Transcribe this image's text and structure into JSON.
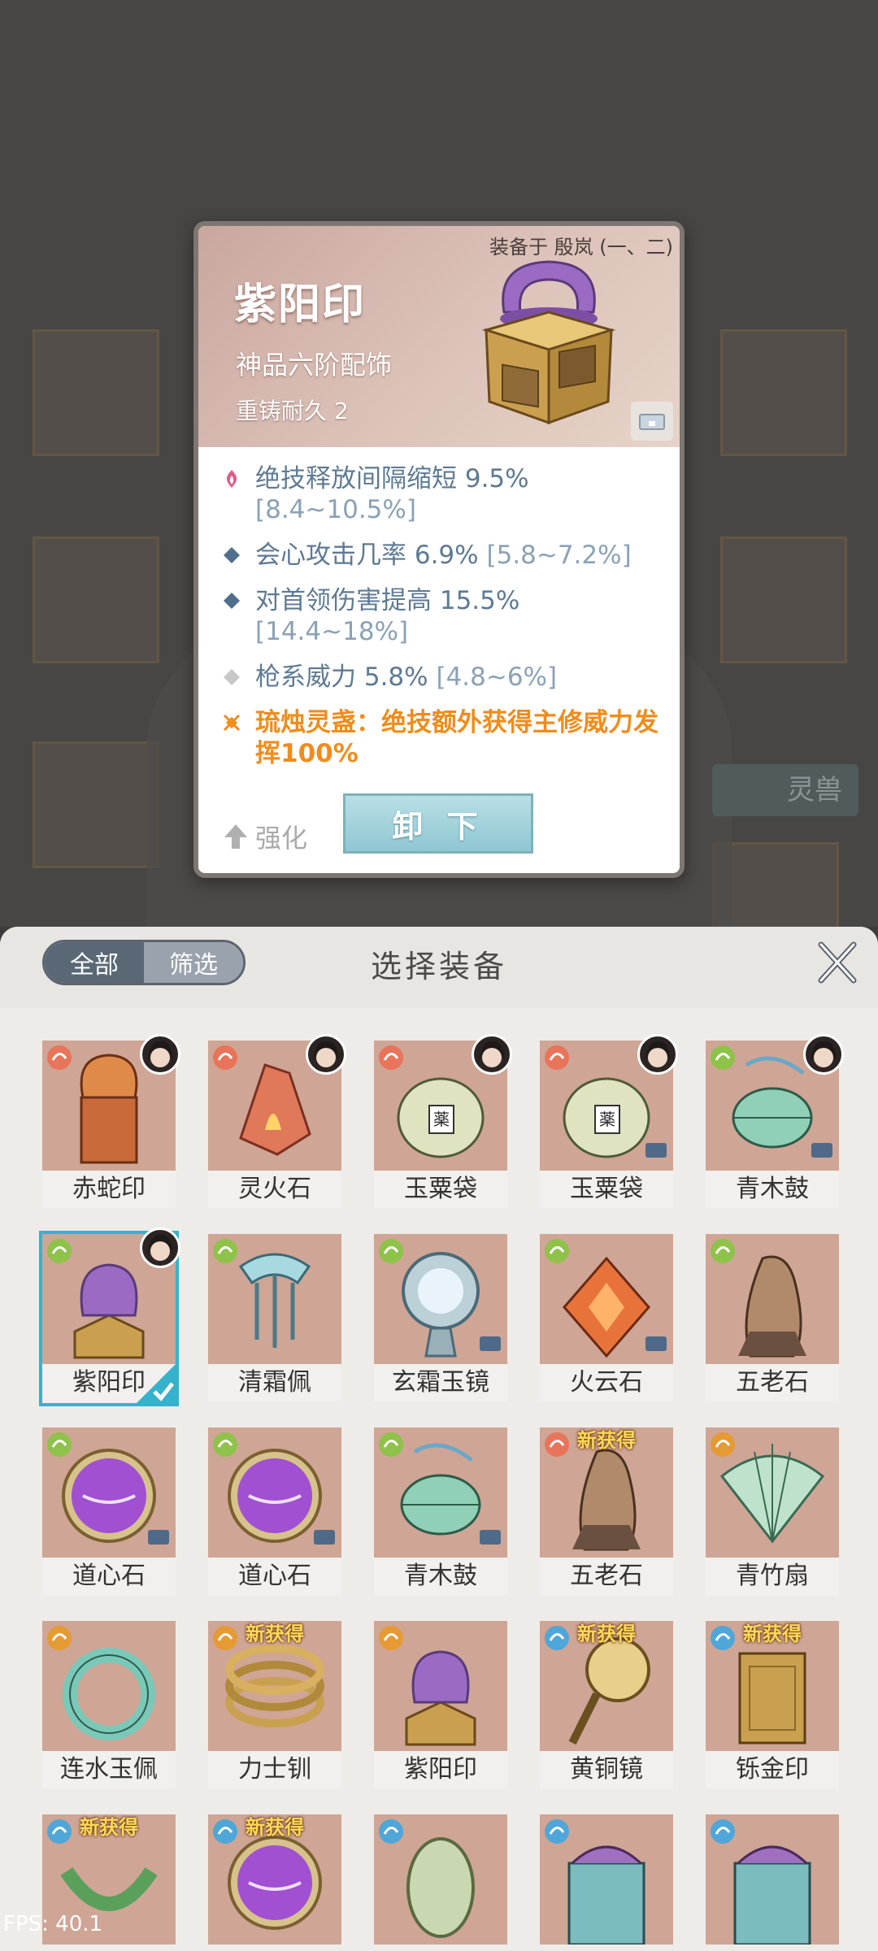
{
  "detail": {
    "equipped_note": "装备于 殷岚 (一、二)",
    "name": "紫阳印",
    "grade": "神品六阶配饰",
    "durability": "重铸耐久 2",
    "stats": [
      {
        "icon": "flame-icon",
        "text": "绝技释放间隔缩短 9.5% ",
        "range": "[8.4~10.5%]",
        "color": "#c55a7a"
      },
      {
        "icon": "diamond-icon",
        "text": "会心攻击几率 6.9% ",
        "range": "[5.8~7.2%]",
        "color": "#4f6f8c"
      },
      {
        "icon": "diamond-icon",
        "text": "对首领伤害提高 15.5% ",
        "range": "[14.4~18%]",
        "color": "#4f6f8c"
      },
      {
        "icon": "diamond-icon",
        "text": "枪系威力 5.8% ",
        "range": "[4.8~6%]",
        "color": "#bbbbbb"
      }
    ],
    "special": {
      "icon": "rune-icon",
      "text": "琉烛灵盏：绝技额外获得主修威力发挥100%"
    },
    "enhance_label": "强化",
    "unequip_label": "卸 下"
  },
  "panel": {
    "tabs": [
      {
        "label": "全部",
        "active": true
      },
      {
        "label": "筛选",
        "active": false
      }
    ],
    "title": "选择装备"
  },
  "items": [
    {
      "name": "赤蛇印",
      "rarity": "red",
      "owner": true,
      "art": "seal-orange"
    },
    {
      "name": "灵火石",
      "rarity": "red",
      "owner": true,
      "art": "fire-stone"
    },
    {
      "name": "玉粟袋",
      "rarity": "red",
      "owner": true,
      "art": "pouch"
    },
    {
      "name": "玉粟袋",
      "rarity": "red",
      "owner": true,
      "chest": true,
      "art": "pouch"
    },
    {
      "name": "青木鼓",
      "rarity": "green",
      "owner": true,
      "chest": true,
      "art": "drum"
    },
    {
      "name": "紫阳印",
      "rarity": "green",
      "owner": true,
      "selected": true,
      "art": "seal-purple"
    },
    {
      "name": "清霜佩",
      "rarity": "green",
      "art": "pendant"
    },
    {
      "name": "玄霜玉镜",
      "rarity": "green",
      "chest": true,
      "art": "mirror"
    },
    {
      "name": "火云石",
      "rarity": "green",
      "chest": true,
      "art": "fire-cloud"
    },
    {
      "name": "五老石",
      "rarity": "green",
      "art": "old-stone"
    },
    {
      "name": "道心石",
      "rarity": "green",
      "chest": true,
      "art": "purple-orb"
    },
    {
      "name": "道心石",
      "rarity": "green",
      "chest": true,
      "art": "purple-orb"
    },
    {
      "name": "青木鼓",
      "rarity": "green",
      "chest": true,
      "art": "drum"
    },
    {
      "name": "五老石",
      "rarity": "red",
      "new": true,
      "art": "old-stone"
    },
    {
      "name": "青竹扇",
      "rarity": "orange",
      "art": "fan"
    },
    {
      "name": "连水玉佩",
      "rarity": "orange",
      "art": "jade-ring"
    },
    {
      "name": "力士钏",
      "rarity": "orange",
      "new": true,
      "art": "bracelet"
    },
    {
      "name": "紫阳印",
      "rarity": "orange",
      "art": "seal-purple"
    },
    {
      "name": "黄铜镜",
      "rarity": "blue",
      "new": true,
      "art": "bronze-mirror"
    },
    {
      "name": "铄金印",
      "rarity": "blue",
      "new": true,
      "art": "gold-seal"
    },
    {
      "name": "",
      "rarity": "blue",
      "new": true,
      "art": "green-ring"
    },
    {
      "name": "",
      "rarity": "blue",
      "new": true,
      "art": "purple-orb"
    },
    {
      "name": "",
      "rarity": "blue",
      "art": "jade-disc"
    },
    {
      "name": "",
      "rarity": "blue",
      "art": "cauldron"
    },
    {
      "name": "",
      "rarity": "blue",
      "art": "cauldron"
    }
  ],
  "new_label": "新获得",
  "colors": {
    "red": "#e8745a",
    "green": "#8fc24a",
    "orange": "#e59a34",
    "blue": "#4fa6d8",
    "selected": "#36b3cc"
  },
  "fps": "FPS: 40.1"
}
